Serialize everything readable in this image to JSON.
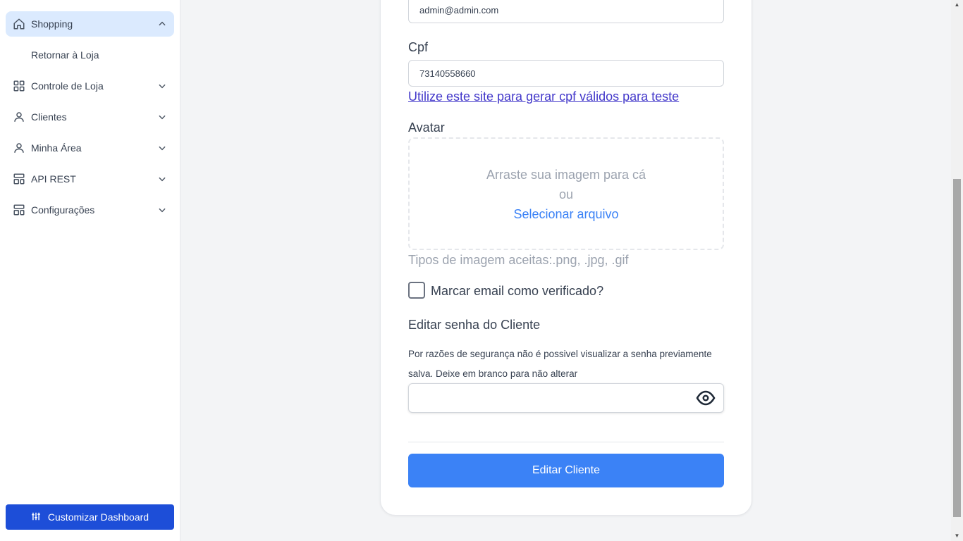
{
  "sidebar": {
    "items": [
      {
        "label": "Shopping",
        "icon": "home-icon",
        "expanded": true
      },
      {
        "label": "Controle de Loja",
        "icon": "grid-icon"
      },
      {
        "label": "Clientes",
        "icon": "user-icon"
      },
      {
        "label": "Minha Área",
        "icon": "user-icon"
      },
      {
        "label": "API REST",
        "icon": "layout-icon"
      },
      {
        "label": "Configurações",
        "icon": "layout-icon"
      }
    ],
    "subitem": "Retornar à Loja",
    "customize_label": "Customizar Dashboard"
  },
  "form": {
    "email_value": "admin@admin.com",
    "cpf_label": "Cpf",
    "cpf_value": "73140558660",
    "cpf_link": "Utilize este site para gerar cpf válidos para teste",
    "avatar_label": "Avatar",
    "dropzone_line1": "Arraste sua imagem para cá",
    "dropzone_line2": "ou",
    "dropzone_select": "Selecionar arquivo",
    "image_types_hint": "Tipos de imagem aceitas:.png, .jpg, .gif",
    "verify_email_label": "Marcar email como verificado?",
    "verify_email_checked": false,
    "password_section_title": "Editar senha do Cliente",
    "password_note": " Por razões de segurança não é possivel visualizar a senha previamente salva. Deixe em branco para não alterar",
    "password_value": "",
    "submit_label": "Editar Cliente"
  },
  "colors": {
    "primary": "#3b82f6",
    "sidebar_button": "#1d4ed8",
    "active_nav": "#dbeafe",
    "link": "#4338ca"
  }
}
